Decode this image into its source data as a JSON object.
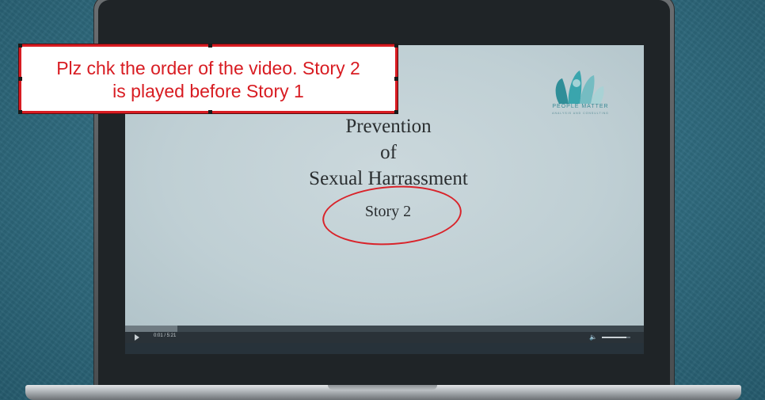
{
  "callout": {
    "line1": "Plz chk the order of the video. Story 2",
    "line2": "is played before Story 1"
  },
  "slide": {
    "title": "Prevention\nof\nSexual Harrassment",
    "story_label": "Story 2",
    "logo_text": "PEOPLE MATTER",
    "logo_subtext": "ANALYSIS AND CONSULTING"
  },
  "player": {
    "time_readout": "0:01  /  5:21",
    "progress": 0.1,
    "volume": 0.85
  },
  "colors": {
    "annotation_red": "#d81c22",
    "logo_teal": "#3a8a95"
  }
}
